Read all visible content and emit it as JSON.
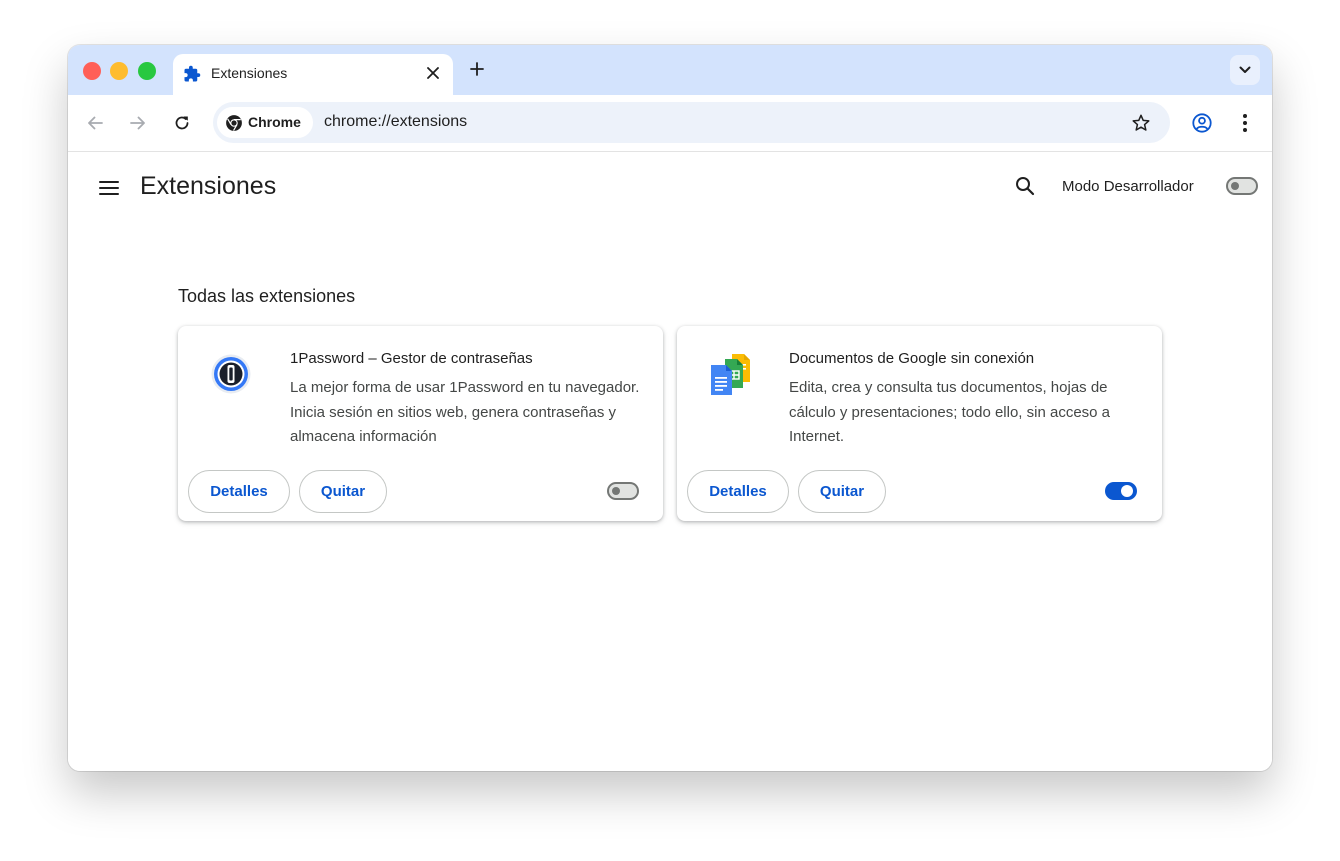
{
  "colors": {
    "accent": "#0b57d0",
    "tabstrip": "#d3e3fd",
    "omnibox": "#edf2fa",
    "close_red": "#ff5f57",
    "minimize_yellow": "#febc2e",
    "zoom_green": "#28c840"
  },
  "tab": {
    "title": "Extensiones",
    "icon": "puzzle-icon"
  },
  "toolbar": {
    "chip_label": "Chrome",
    "url": "chrome://extensions"
  },
  "page": {
    "title": "Extensiones",
    "developer_mode_label": "Modo Desarrollador",
    "developer_mode_enabled": false,
    "section_title": "Todas las extensiones"
  },
  "extensions": [
    {
      "name": "1Password – Gestor de contraseñas",
      "description": "La mejor forma de usar 1Password en tu navegador. Inicia sesión en sitios web, genera contraseñas y almacena información",
      "details_label": "Detalles",
      "remove_label": "Quitar",
      "enabled": false,
      "icon": "onepassword-icon"
    },
    {
      "name": "Documentos de Google sin conexión",
      "description": "Edita, crea y consulta tus documentos, hojas de cálculo y presentaciones; todo ello, sin acceso a Internet.",
      "details_label": "Detalles",
      "remove_label": "Quitar",
      "enabled": true,
      "icon": "google-docs-icon"
    }
  ]
}
